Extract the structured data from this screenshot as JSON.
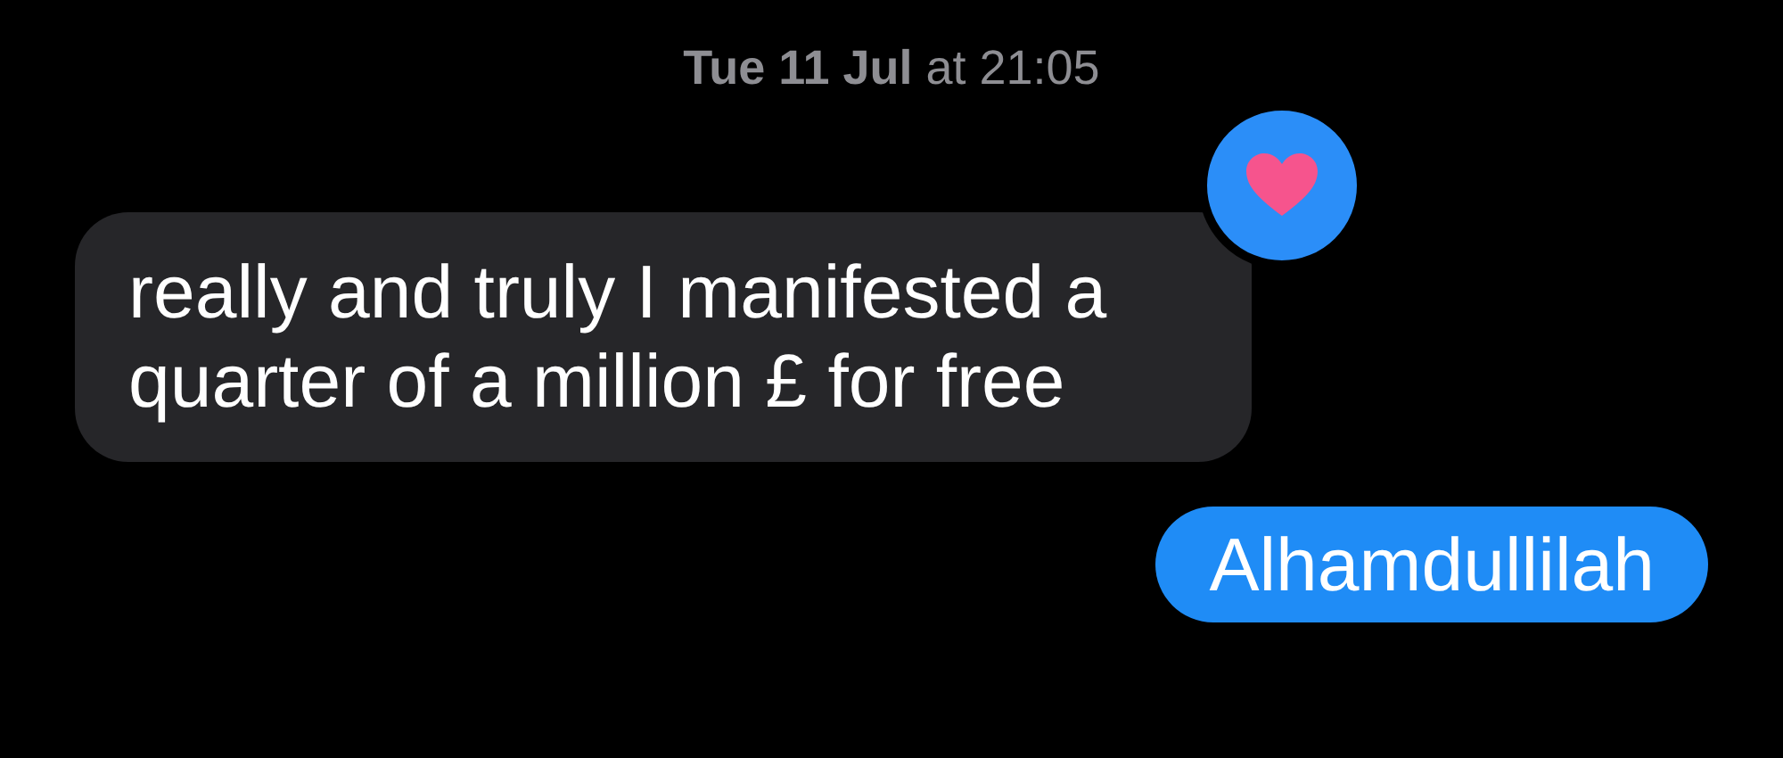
{
  "timestamp": "**Tue 11 Jul** at 21:05",
  "messages": [
    {
      "kind": "incoming",
      "text": "really and truly I manifested a quarter of a million £ for free",
      "reaction": {
        "kind": "heart"
      }
    },
    {
      "kind": "outgoing",
      "text": "Alhamdullilah"
    }
  ]
}
